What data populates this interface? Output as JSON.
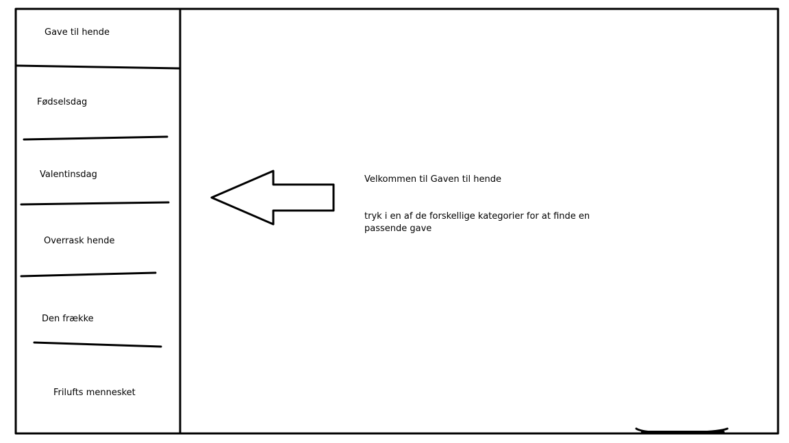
{
  "sidebar": {
    "items": [
      {
        "label": "Gave til hende"
      },
      {
        "label": "Fødselsdag"
      },
      {
        "label": "Valentinsdag"
      },
      {
        "label": "Overrask hende"
      },
      {
        "label": "Den frække"
      },
      {
        "label": "Frilufts mennesket"
      }
    ]
  },
  "main": {
    "title": "Velkommen til Gaven til hende",
    "instruction": "tryk i en af de forskellige kategorier for at finde en passende gave"
  },
  "icons": {
    "pointer": "left-arrow-icon"
  }
}
